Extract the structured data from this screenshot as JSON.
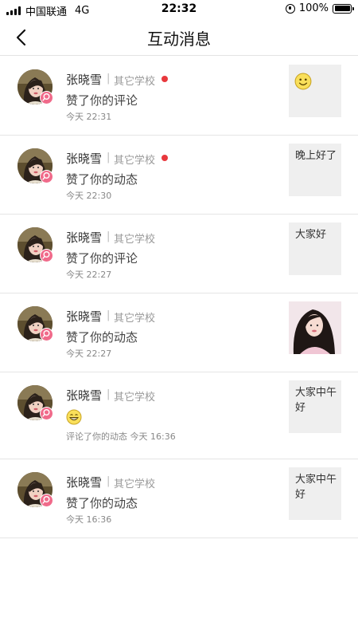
{
  "status_bar": {
    "carrier": "中国联通",
    "network": "4G",
    "time": "22:32",
    "battery": "100%"
  },
  "nav": {
    "title": "互动消息",
    "back_icon": "chevron-left-icon"
  },
  "items": [
    {
      "name": "张晓雪",
      "school": "其它学校",
      "unread": true,
      "action": "赞了你的评论",
      "action_type": "text",
      "time": "今天 22:31",
      "thumb_type": "emoji",
      "thumb_text": ""
    },
    {
      "name": "张晓雪",
      "school": "其它学校",
      "unread": true,
      "action": "赞了你的动态",
      "action_type": "text",
      "time": "今天 22:30",
      "thumb_type": "text",
      "thumb_text": "晚上好了"
    },
    {
      "name": "张晓雪",
      "school": "其它学校",
      "unread": false,
      "action": "赞了你的评论",
      "action_type": "text",
      "time": "今天 22:27",
      "thumb_type": "text",
      "thumb_text": "大家好"
    },
    {
      "name": "张晓雪",
      "school": "其它学校",
      "unread": false,
      "action": "赞了你的动态",
      "action_type": "text",
      "time": "今天 22:27",
      "thumb_type": "photo",
      "thumb_text": ""
    },
    {
      "name": "张晓雪",
      "school": "其它学校",
      "unread": false,
      "action": "",
      "action_type": "emoji",
      "time": "评论了你的动态 今天 16:36",
      "thumb_type": "text",
      "thumb_text": "大家中午好"
    },
    {
      "name": "张晓雪",
      "school": "其它学校",
      "unread": false,
      "action": "赞了你的动态",
      "action_type": "text",
      "time": "今天 16:36",
      "thumb_type": "text",
      "thumb_text": "大家中午好"
    }
  ],
  "colors": {
    "unread_dot": "#e8383d",
    "badge": "#f06a8a",
    "divider": "#e5e5e5",
    "thumb_bg": "#efefef"
  }
}
